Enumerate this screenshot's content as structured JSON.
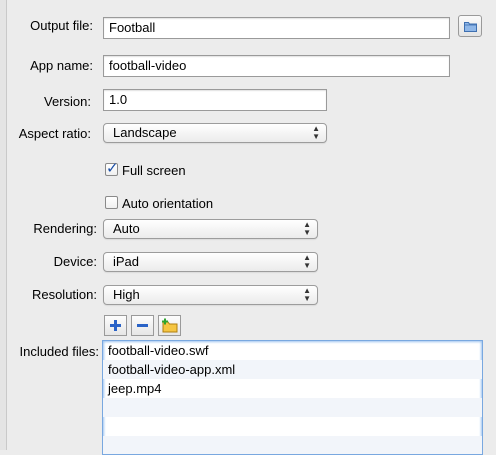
{
  "output_file": {
    "label": "Output file:",
    "value": "Football"
  },
  "app_name": {
    "label": "App name:",
    "value": "football-video"
  },
  "version": {
    "label": "Version:",
    "value": "1.0"
  },
  "aspect_ratio": {
    "label": "Aspect ratio:",
    "value": "Landscape"
  },
  "full_screen": {
    "label": "Full screen",
    "checked": true
  },
  "auto_orientation": {
    "label": "Auto orientation",
    "checked": false
  },
  "rendering": {
    "label": "Rendering:",
    "value": "Auto"
  },
  "device": {
    "label": "Device:",
    "value": "iPad"
  },
  "resolution": {
    "label": "Resolution:",
    "value": "High"
  },
  "included_files": {
    "label": "Included files:",
    "files": [
      "football-video.swf",
      "football-video-app.xml",
      "jeep.mp4",
      "",
      "",
      ""
    ]
  },
  "icons": {
    "add": "plus-icon",
    "remove": "minus-icon",
    "add_folder": "folder-add-icon",
    "browse": "folder-icon"
  }
}
